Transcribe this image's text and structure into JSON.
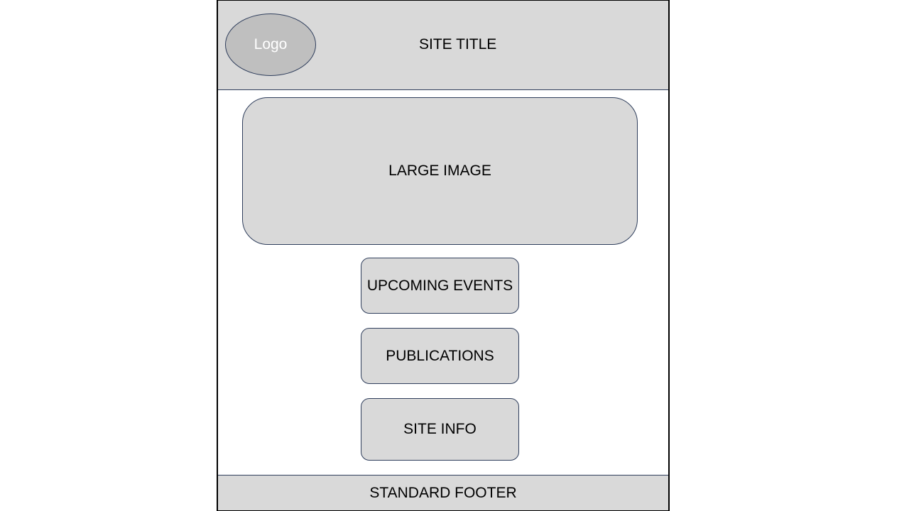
{
  "header": {
    "logo_label": "Logo",
    "site_title": "SITE TITLE"
  },
  "main": {
    "large_image_label": "LARGE IMAGE",
    "buttons": [
      {
        "label": "UPCOMING EVENTS"
      },
      {
        "label": "PUBLICATIONS"
      },
      {
        "label": "SITE INFO"
      }
    ]
  },
  "footer": {
    "label": "STANDARD FOOTER"
  },
  "colors": {
    "box_fill": "#d9d9d9",
    "logo_fill": "#bfbfbf",
    "outline": "#2f3e5c",
    "logo_text": "#ffffff"
  }
}
